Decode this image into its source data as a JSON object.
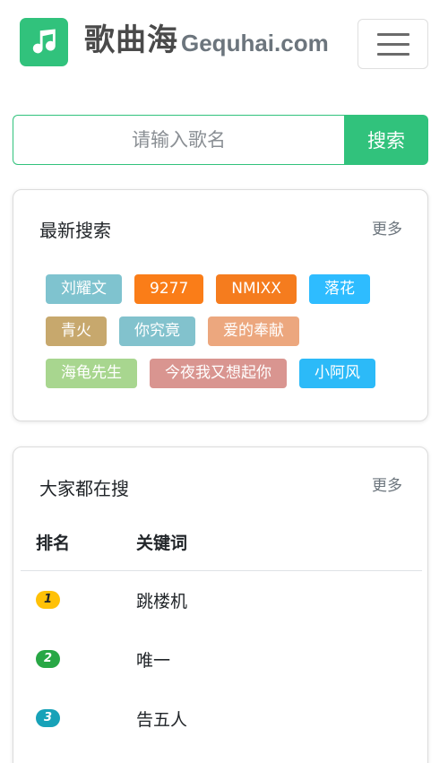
{
  "header": {
    "brand_name": "歌曲海",
    "brand_domain": "Gequhai.com"
  },
  "search": {
    "placeholder": "请输入歌名",
    "button_label": "搜索"
  },
  "recent": {
    "title": "最新搜索",
    "more_label": "更多",
    "tags": [
      {
        "label": "刘耀文",
        "color": "#7fc3cf"
      },
      {
        "label": "9277",
        "color": "#fa7d18"
      },
      {
        "label": "NMIXX",
        "color": "#f57c1e"
      },
      {
        "label": "落花",
        "color": "#2ebcff"
      },
      {
        "label": "青火",
        "color": "#c7a86d"
      },
      {
        "label": "你究竟",
        "color": "#82c2cd"
      },
      {
        "label": "爱的奉献",
        "color": "#eca77e"
      },
      {
        "label": "海龟先生",
        "color": "#a8d68f"
      },
      {
        "label": "今夜我又想起你",
        "color": "#d99590"
      },
      {
        "label": "小阿风",
        "color": "#2cbaf8"
      }
    ]
  },
  "hot": {
    "title": "大家都在搜",
    "more_label": "更多",
    "columns": [
      "排名",
      "关键词"
    ],
    "rows": [
      {
        "rank": "1",
        "keyword": "跳楼机",
        "badge_color": "#ffc107",
        "badge_text_color": "#212529"
      },
      {
        "rank": "2",
        "keyword": "唯一",
        "badge_color": "#28a745",
        "badge_text_color": "#ffffff"
      },
      {
        "rank": "3",
        "keyword": "告五人",
        "badge_color": "#17a2b8",
        "badge_text_color": "#ffffff"
      }
    ]
  },
  "colors": {
    "brand_green": "#31c27c"
  }
}
